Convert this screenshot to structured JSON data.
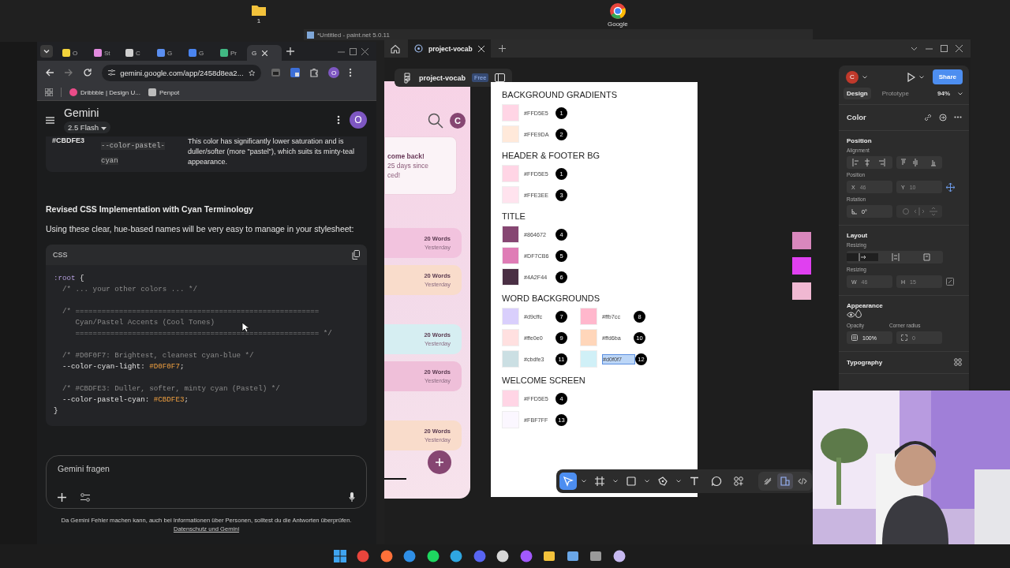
{
  "desktop_icons": [
    {
      "kind": "folder",
      "label": "1"
    },
    {
      "kind": "chrome",
      "label": "Google"
    }
  ],
  "paint_window": {
    "title": "*Untitled - paint.net 5.0.11"
  },
  "browser": {
    "tabs": [
      {
        "kind": "note",
        "label": "O",
        "selected": false
      },
      {
        "label": "St",
        "selected": false
      },
      {
        "kind": "spiral",
        "label": "C",
        "selected": false
      },
      {
        "kind": "star",
        "label": "G",
        "selected": false
      },
      {
        "kind": "translate",
        "label": "G",
        "selected": false
      },
      {
        "kind": "vee",
        "label": "Pr",
        "selected": false
      },
      {
        "kind": "plain",
        "label": "G",
        "selected": true
      }
    ],
    "url": "gemini.google.com/app/2458d8ea2...",
    "profile": "O",
    "bookmarks": [
      {
        "kind": "ball",
        "label": "Dribbble | Design U..."
      },
      {
        "kind": "pot",
        "label": "Penpot"
      }
    ]
  },
  "gemini": {
    "title": "Gemini",
    "model": "2.5 Flash",
    "avatar": "O",
    "table_row": {
      "hex": "#CBDFE3",
      "variable": "--color-pastel-cyan",
      "description": "This color has significantly lower saturation and is duller/softer (more \"pastel\"), which suits its minty-teal appearance."
    },
    "heading": "Revised CSS Implementation with Cyan Terminology",
    "intro": "Using these clear, hue-based names will be very easy to manage in your stylesheet:",
    "code": {
      "language": "CSS",
      "blocks": [
        [
          [
            {
              "kind": "selector",
              "text": ":root"
            },
            {
              "kind": "punct",
              "text": " {"
            }
          ],
          [
            {
              "kind": "comment",
              "text": "  /* ... your other colors ... */"
            }
          ]
        ],
        [
          [
            {
              "kind": "comment",
              "text": "  /* ========================================================"
            }
          ],
          [
            {
              "kind": "comment",
              "text": "     Cyan/Pastel Accents (Cool Tones)"
            }
          ],
          [
            {
              "kind": "comment",
              "text": "     ======================================================== */"
            }
          ]
        ],
        [
          [
            {
              "kind": "comment",
              "text": "  /* #D0F0F7: Brightest, cleanest cyan-blue */"
            }
          ],
          [
            {
              "kind": "prop",
              "text": "  --color-cyan-light: "
            },
            {
              "kind": "value",
              "text": "#D0F0F7"
            },
            {
              "kind": "punct",
              "text": ";"
            }
          ]
        ],
        [
          [
            {
              "kind": "comment",
              "text": "  /* #CBDFE3: Duller, softer, minty cyan (Pastel) */"
            }
          ],
          [
            {
              "kind": "prop",
              "text": "  --color-pastel-cyan: "
            },
            {
              "kind": "value",
              "text": "#CBDFE3"
            },
            {
              "kind": "punct",
              "text": ";"
            }
          ],
          [
            {
              "kind": "punct",
              "text": "}"
            }
          ]
        ]
      ]
    },
    "prompt": {
      "placeholder": "Gemini fragen"
    },
    "disclaimer": "Da Gemini Fehler machen kann, auch bei Informationen über Personen, solltest du die Antworten überprüfen.",
    "privacy_link": "Datenschutz und Gemini"
  },
  "figma": {
    "tab": "project-vocab",
    "file": {
      "name": "project-vocab",
      "plan": "Free"
    },
    "phone": {
      "welcome": [
        "come back!",
        "25 days since",
        "ced!"
      ],
      "avatar": "C",
      "cards": [
        {
          "count": "20 Words",
          "when": "Yesterday",
          "color": "#f2c3de"
        },
        {
          "count": "20 Words",
          "when": "Yesterday",
          "color": "#f9dccb"
        },
        {
          "count": "20 Words",
          "when": "Yesterday",
          "color": "#d6eef2"
        },
        {
          "count": "20 Words",
          "when": "Yesterday",
          "color": "#efbfd9"
        },
        {
          "count": "20 Words",
          "when": "Yesterday",
          "color": "#f9dccb"
        }
      ]
    },
    "board": {
      "sections": [
        {
          "title": "BACKGROUND GRADIENTS",
          "kind": "list",
          "swatches": [
            {
              "color": "#ffd5e5",
              "hex": "#FFD5E5",
              "badge": "1",
              "selected": false
            },
            {
              "color": "#ffe9da",
              "hex": "#FFE9DA",
              "badge": "2",
              "selected": false
            }
          ]
        },
        {
          "title": "HEADER & FOOTER BG",
          "kind": "list",
          "swatches": [
            {
              "color": "#ffd5e5",
              "hex": "#FFD5E5",
              "badge": "1",
              "selected": false
            },
            {
              "color": "#ffe3ee",
              "hex": "#FFE3EE",
              "badge": "3",
              "selected": false
            }
          ]
        },
        {
          "title": "TITLE",
          "kind": "list",
          "swatches": [
            {
              "color": "#864672",
              "hex": "#864672",
              "badge": "4",
              "selected": false
            },
            {
              "color": "#df7cb6",
              "hex": "#DF7CB6",
              "badge": "5",
              "selected": false
            },
            {
              "color": "#4a2f44",
              "hex": "#4A2F44",
              "badge": "6",
              "selected": false
            }
          ]
        },
        {
          "title": "WORD BACKGROUNDS",
          "kind": "grid",
          "swatches": [
            {
              "color": "#d9cffc",
              "hex": "#d9cffc",
              "badge": "7",
              "selected": false
            },
            {
              "color": "#ffb7cc",
              "hex": "#ffb7cc",
              "badge": "8",
              "selected": false
            },
            {
              "color": "#ffe0e0",
              "hex": "#ffe0e0",
              "badge": "9",
              "selected": false
            },
            {
              "color": "#ffd6ba",
              "hex": "#ffd6ba",
              "badge": "10",
              "selected": false
            },
            {
              "color": "#cbdfe3",
              "hex": "#cbdfe3",
              "badge": "11",
              "selected": false
            },
            {
              "color": "#d0f0f7",
              "hex": "#d0f0f7",
              "badge": "12",
              "selected": true
            }
          ]
        },
        {
          "title": "WELCOME SCREEN",
          "kind": "list",
          "swatches": [
            {
              "color": "#ffd5e5",
              "hex": "#FFD5E5",
              "badge": "4",
              "selected": false
            },
            {
              "color": "#fbf7ff",
              "hex": "#FBF7FF",
              "badge": "13",
              "selected": false
            }
          ]
        }
      ]
    },
    "canvas_swatches": [
      {
        "color": "#d987bd"
      },
      {
        "color": "#e040f0"
      },
      {
        "color": "#f0b8d2"
      }
    ],
    "tools": [
      {
        "kind": "move",
        "selected": true,
        "dropdown": true
      },
      {
        "kind": "frame",
        "selected": false,
        "dropdown": true
      },
      {
        "kind": "shape",
        "selected": false,
        "dropdown": true
      },
      {
        "kind": "pen",
        "selected": false,
        "dropdown": true
      },
      {
        "kind": "text",
        "selected": false,
        "dropdown": false
      },
      {
        "kind": "comment",
        "selected": false,
        "dropdown": false
      },
      {
        "kind": "components",
        "selected": false,
        "dropdown": false
      }
    ],
    "modes": [
      {
        "kind": "draw",
        "selected": false
      },
      {
        "kind": "design",
        "selected": true
      },
      {
        "kind": "dev",
        "selected": false
      }
    ],
    "panel": {
      "avatar": "C",
      "share": "Share",
      "tabs": [
        {
          "label": "Design",
          "selected": true
        },
        {
          "label": "Prototype",
          "selected": false
        }
      ],
      "zoom": "94%",
      "layer": "Color",
      "position": {
        "title": "Position",
        "alignment_label": "Alignment",
        "position_label": "Position",
        "x": {
          "label": "X",
          "value": "46"
        },
        "y": {
          "label": "Y",
          "value": "10"
        },
        "rotation_label": "Rotation",
        "rotation": "0°"
      },
      "layout": {
        "title": "Layout",
        "resizing_label": "Resizing",
        "size_label": "Resizing",
        "w": {
          "label": "W",
          "value": "46"
        },
        "h": {
          "label": "H",
          "value": "15"
        }
      },
      "appearance": {
        "title": "Appearance",
        "opacity_label": "Opacity",
        "opacity": "100%",
        "radius_label": "Corner radius",
        "radius": "0"
      },
      "typography": {
        "title": "Typography"
      }
    }
  },
  "taskbar": [
    {
      "kind": "start"
    },
    {
      "kind": "chrome"
    },
    {
      "kind": "fox"
    },
    {
      "kind": "code"
    },
    {
      "kind": "music"
    },
    {
      "kind": "wave"
    },
    {
      "kind": "chat"
    },
    {
      "kind": "alert"
    },
    {
      "kind": "figma"
    },
    {
      "kind": "folder"
    },
    {
      "kind": "paint"
    },
    {
      "kind": "terminal"
    },
    {
      "kind": "cat"
    }
  ]
}
